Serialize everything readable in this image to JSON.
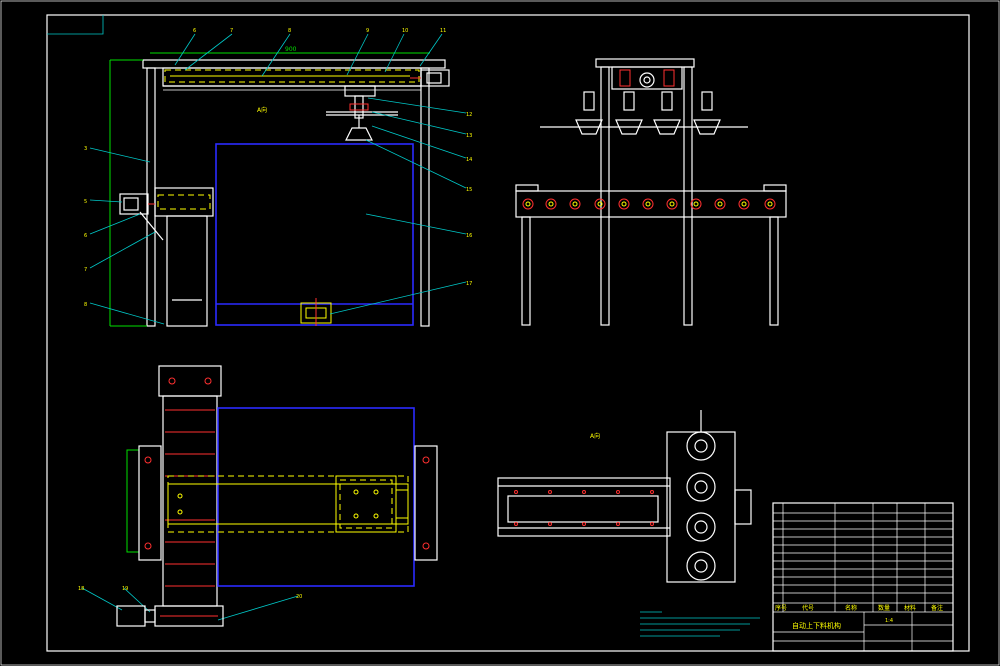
{
  "drawing": {
    "title_block_name": "自动上下料机构",
    "scale_value": "1:4",
    "view_label_a": "A向",
    "view_label_b": "A向",
    "header_cols": [
      "序号",
      "代号",
      "名称",
      "数量",
      "材料",
      "备注"
    ],
    "part_numbers_left": [
      "3",
      "5",
      "6",
      "7",
      "8"
    ],
    "part_numbers_top": [
      "6",
      "7",
      "8",
      "9",
      "10",
      "11"
    ],
    "part_numbers_right": [
      "12",
      "13",
      "14",
      "15",
      "16",
      "17"
    ],
    "part_numbers_bottom": [
      "18",
      "19",
      "20"
    ],
    "dimension_top": "900",
    "colors": {
      "background": "#000000",
      "outline": "#ffffff",
      "yellow": "#ffff00",
      "blue": "#2a2aff",
      "cyan": "#00c8c8",
      "green": "#00e000",
      "red": "#ff3030"
    }
  }
}
